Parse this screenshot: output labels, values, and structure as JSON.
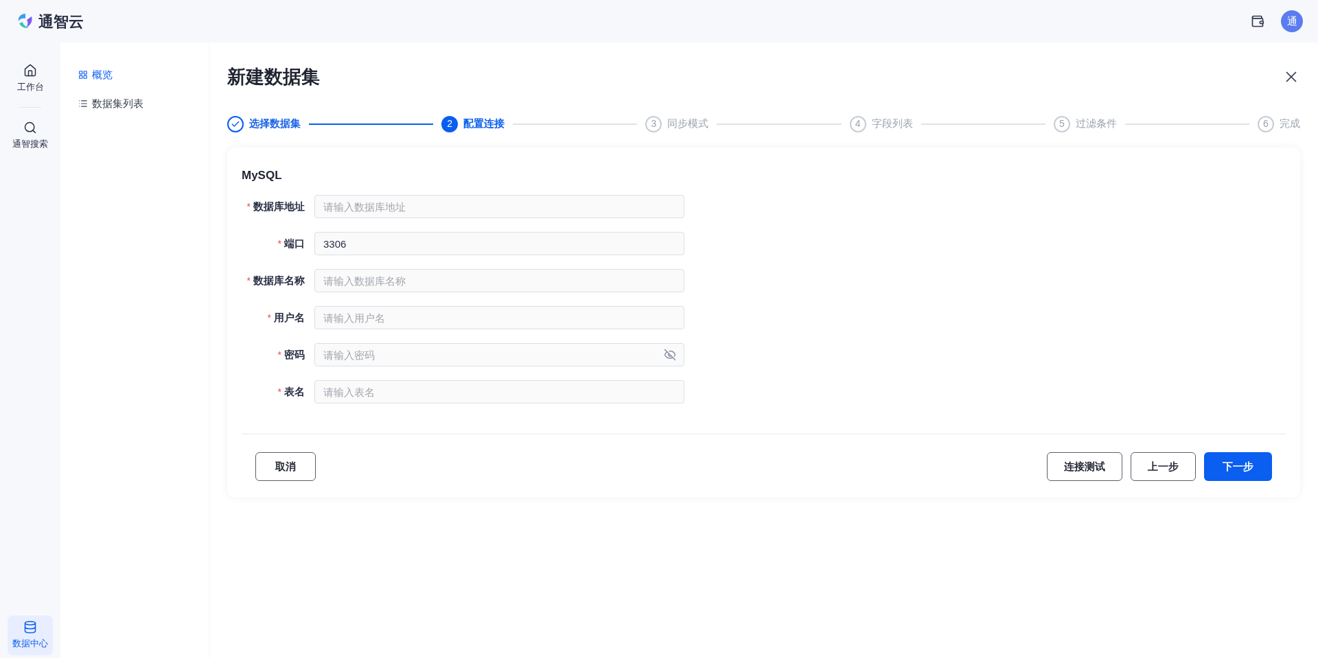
{
  "header": {
    "brand": "通智云",
    "avatar": "通"
  },
  "rail": [
    {
      "label": "工作台",
      "selected": false
    },
    {
      "label": "通智搜索",
      "selected": false
    },
    {
      "label": "数据中心",
      "selected": true
    }
  ],
  "sidebar": {
    "items": [
      {
        "label": "概览",
        "selected": true
      },
      {
        "label": "数据集列表",
        "selected": false
      }
    ]
  },
  "dialog": {
    "title": "新建数据集",
    "steps": [
      {
        "label": "选择数据集",
        "done": true,
        "selected": false
      },
      {
        "number": "2",
        "label": "配置连接",
        "done": false,
        "selected": true
      },
      {
        "number": "3",
        "label": "同步模式",
        "done": false,
        "selected": false
      },
      {
        "number": "4",
        "label": "字段列表",
        "done": false,
        "selected": false
      },
      {
        "number": "5",
        "label": "过滤条件",
        "done": false,
        "selected": false
      },
      {
        "number": "6",
        "label": "完成",
        "done": false,
        "selected": false
      }
    ],
    "section_title": "MySQL",
    "fields": [
      {
        "marker": "*",
        "label": "数据库地址",
        "kind": "text",
        "placeholder": "请输入数据库地址"
      },
      {
        "marker": "*",
        "label": "端口",
        "kind": "text",
        "value": "3306"
      },
      {
        "marker": "*",
        "label": "数据库名称",
        "kind": "text",
        "placeholder": "请输入数据库名称"
      },
      {
        "marker": "*",
        "label": "用户名",
        "kind": "text",
        "placeholder": "请输入用户名"
      },
      {
        "marker": "*",
        "label": "密码",
        "kind": "password",
        "placeholder": "请输入密码"
      },
      {
        "marker": "*",
        "label": "表名",
        "kind": "text",
        "placeholder": "请输入表名"
      }
    ],
    "buttons_left": [
      {
        "label": "取消"
      }
    ],
    "buttons_right": [
      {
        "label": "连接测试",
        "kind": "secondary"
      },
      {
        "label": "上一步",
        "kind": "secondary"
      },
      {
        "label": "下一步",
        "kind": "primary"
      }
    ]
  }
}
